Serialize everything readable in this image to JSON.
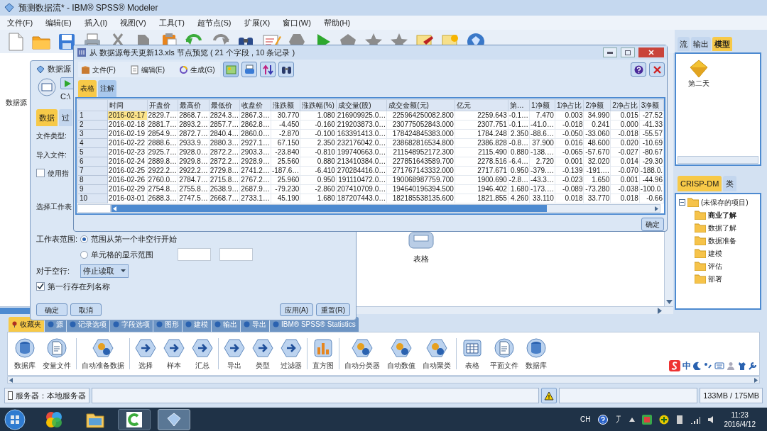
{
  "app": {
    "title": "预测数据流* - IBM® SPSS® Modeler",
    "menu": [
      "文件(F)",
      "编辑(E)",
      "插入(I)",
      "视图(V)",
      "工具(T)",
      "超节点(S)",
      "扩展(X)",
      "窗口(W)",
      "帮助(H)"
    ]
  },
  "canvas": {
    "nodes": [
      {
        "label": "数据源",
        "kind": "hidden"
      },
      {
        "label": "表格",
        "kind": "table"
      }
    ]
  },
  "managers": {
    "tabs": [
      {
        "label": "流",
        "selected": false
      },
      {
        "label": "输出",
        "selected": false
      },
      {
        "label": "模型",
        "selected": true
      }
    ],
    "models": [
      {
        "label": "第二天"
      }
    ]
  },
  "project": {
    "tabs": [
      {
        "label": "CRISP-DM",
        "selected": true
      },
      {
        "label": "类",
        "selected": false
      }
    ],
    "tree": {
      "label": "(未保存的项目)",
      "expanded": true,
      "children": [
        {
          "label": "商业了解",
          "bold": true
        },
        {
          "label": "数据了解",
          "bold": false
        },
        {
          "label": "数据准备",
          "bold": false
        },
        {
          "label": "建模",
          "bold": false
        },
        {
          "label": "评估",
          "bold": false
        },
        {
          "label": "部署",
          "bold": false
        }
      ]
    }
  },
  "palette": {
    "tabs": [
      {
        "label": "收藏夹",
        "selected": true
      },
      {
        "label": "源",
        "selected": false
      },
      {
        "label": "记录选项",
        "selected": false
      },
      {
        "label": "字段选项",
        "selected": false
      },
      {
        "label": "图形",
        "selected": false
      },
      {
        "label": "建模",
        "selected": false
      },
      {
        "label": "输出",
        "selected": false
      },
      {
        "label": "导出",
        "selected": false
      },
      {
        "label": "IBM® SPSS® Statistics",
        "selected": false
      }
    ],
    "groups": [
      [
        {
          "label": "数据库",
          "kind": "database"
        },
        {
          "label": "变量文件",
          "kind": "file"
        }
      ],
      [
        {
          "label": "自动准备数据",
          "kind": "model"
        }
      ],
      [
        {
          "label": "选择",
          "kind": "process"
        },
        {
          "label": "样本",
          "kind": "process"
        },
        {
          "label": "汇总",
          "kind": "process"
        }
      ],
      [
        {
          "label": "导出",
          "kind": "process"
        },
        {
          "label": "类型",
          "kind": "process"
        },
        {
          "label": "过滤器",
          "kind": "process"
        }
      ],
      [
        {
          "label": "直方图",
          "kind": "chart"
        }
      ],
      [
        {
          "label": "自动分类器",
          "kind": "model"
        },
        {
          "label": "自动数值",
          "kind": "model"
        },
        {
          "label": "自动聚类",
          "kind": "model"
        }
      ],
      [
        {
          "label": "表格",
          "kind": "table"
        },
        {
          "label": "平面文件",
          "kind": "file"
        },
        {
          "label": "数据库",
          "kind": "database"
        }
      ]
    ]
  },
  "ime_bar": {
    "mode": "中"
  },
  "status_bar": {
    "server": "服务器：本地服务器",
    "memory": "133MB / 175MB"
  },
  "source_dialog": {
    "title": "数据源",
    "path": "C:\\",
    "tabs": [
      {
        "label": "数据",
        "selected": true
      },
      {
        "label": "过",
        "selected": false
      }
    ],
    "file_type_label": "文件类型:",
    "import_file_label": "导入文件:",
    "use_named": {
      "label": "使用指",
      "checked": false
    },
    "sheet_label": "选择工作表",
    "range_label": "工作表范围:",
    "range_options": [
      {
        "label": "范围从第一个非空行开始",
        "selected": true
      },
      {
        "label": "单元格的显示范围",
        "selected": false
      }
    ],
    "blank_rows_label": "对于空行:",
    "blank_rows_value": "停止读取",
    "first_row_names": {
      "label": "第一行存在列名称",
      "checked": true
    },
    "buttons": [
      "确定",
      "取消",
      "应用(A)",
      "重置(R)"
    ]
  },
  "preview": {
    "title": "从 数据源每天更新13.xls 节点预览 ( 21 个字段 , 10 条记录 )",
    "menu": [
      "文件(F)",
      "编辑(E)",
      "生成(G)"
    ],
    "tabs": [
      {
        "label": "表格",
        "selected": true
      },
      {
        "label": "注解",
        "selected": false
      }
    ],
    "table": {
      "columns": [
        {
          "label": "时间",
          "kind": "text"
        },
        {
          "label": "开盘价",
          "kind": "number"
        },
        {
          "label": "最高价",
          "kind": "number"
        },
        {
          "label": "最低价",
          "kind": "number"
        },
        {
          "label": "收盘价",
          "kind": "number"
        },
        {
          "label": "涨跌额",
          "kind": "number"
        },
        {
          "label": "涨跌幅(%)",
          "kind": "number"
        },
        {
          "label": "成交量(股)",
          "kind": "number"
        },
        {
          "label": "成交金额(元)",
          "kind": "number"
        },
        {
          "label": "亿元",
          "kind": "number"
        },
        {
          "label": "第…",
          "kind": "number"
        },
        {
          "label": "1净额",
          "kind": "number"
        },
        {
          "label": "1净占比",
          "kind": "number"
        },
        {
          "label": "2净额",
          "kind": "number"
        },
        {
          "label": "2净占比",
          "kind": "number"
        },
        {
          "label": "3净额",
          "kind": "number"
        }
      ],
      "rows": [
        {
          "number": "1",
          "selected": true,
          "cells": [
            "2016-02-17",
            "2829.7…",
            "2868.7…",
            "2824.3…",
            "2867.3…",
            "30.770",
            "1.080",
            "216909925.0…",
            "225964250082.800",
            "2259.643",
            "-0.1…",
            "7.470",
            "0.003",
            "34.990",
            "0.015",
            "-27.52"
          ]
        },
        {
          "number": "2",
          "selected": false,
          "cells": [
            "2016-02-18",
            "2881.7…",
            "2893.2…",
            "2857.7…",
            "2862.8…",
            "-4.450",
            "-0.160",
            "219203873.0…",
            "230775052843.000",
            "2307.751",
            "-0.1…",
            "-41.0…",
            "-0.018",
            "0.241",
            "0.000",
            "-41.33"
          ]
        },
        {
          "number": "3",
          "selected": false,
          "cells": [
            "2016-02-19",
            "2854.9…",
            "2872.7…",
            "2840.4…",
            "2860.0…",
            "-2.870",
            "-0.100",
            "163391413.0…",
            "178424845383.000",
            "1784.248",
            "2.350",
            "-88.6…",
            "-0.050",
            "-33.060",
            "-0.018",
            "-55.57"
          ]
        },
        {
          "number": "4",
          "selected": false,
          "cells": [
            "2016-02-22",
            "2888.6…",
            "2933.9…",
            "2880.3…",
            "2927.1…",
            "67.150",
            "2.350",
            "232176042.0…",
            "238682816534.800",
            "2386.828",
            "-0.8…",
            "37.900",
            "0.016",
            "48.600",
            "0.020",
            "-10.69"
          ]
        },
        {
          "number": "5",
          "selected": false,
          "cells": [
            "2016-02-23",
            "2925.7…",
            "2928.0…",
            "2872.2…",
            "2903.3…",
            "-23.840",
            "-0.810",
            "199740663.0…",
            "211548952172.300",
            "2115.490",
            "0.880",
            "-138.…",
            "-0.065",
            "-57.670",
            "-0.027",
            "-80.67"
          ]
        },
        {
          "number": "6",
          "selected": false,
          "cells": [
            "2016-02-24",
            "2889.8…",
            "2929.8…",
            "2872.2…",
            "2928.9…",
            "25.560",
            "0.880",
            "213410384.0…",
            "227851643589.700",
            "2278.516",
            "-6.4…",
            "2.720",
            "0.001",
            "32.020",
            "0.014",
            "-29.30"
          ]
        },
        {
          "number": "7",
          "selected": false,
          "cells": [
            "2016-02-25",
            "2922.2…",
            "2922.2…",
            "2729.8…",
            "2741.2…",
            "-187.6…",
            "-6.410",
            "270284416.0…",
            "271767143332.000",
            "2717.671",
            "0.950",
            "-379.…",
            "-0.139",
            "-191.…",
            "-0.070",
            "-188.0."
          ]
        },
        {
          "number": "8",
          "selected": false,
          "cells": [
            "2016-02-26",
            "2760.0…",
            "2784.7…",
            "2715.8…",
            "2767.2…",
            "25.960",
            "0.950",
            "191110472.0…",
            "190068987759.700",
            "1900.690",
            "-2.8…",
            "-43.3…",
            "-0.023",
            "1.650",
            "0.001",
            "-44.96"
          ]
        },
        {
          "number": "9",
          "selected": false,
          "cells": [
            "2016-02-29",
            "2754.8…",
            "2755.8…",
            "2638.9…",
            "2687.9…",
            "-79.230",
            "-2.860",
            "207410709.0…",
            "194640196394.500",
            "1946.402",
            "1.680",
            "-173.…",
            "-0.089",
            "-73.280",
            "-0.038",
            "-100.0."
          ]
        },
        {
          "number": "10",
          "selected": false,
          "cells": [
            "2016-03-01",
            "2688.3…",
            "2747.5…",
            "2668.7…",
            "2733.1…",
            "45.190",
            "1.680",
            "187207443.0…",
            "182185538135.600",
            "1821.855",
            "4.260",
            "33.110",
            "0.018",
            "33.770",
            "0.018",
            "-0.66"
          ]
        }
      ]
    },
    "ok_button": "确定"
  },
  "taskbar": {
    "language": "CH",
    "time": "11:23",
    "date": "2016/4/12"
  }
}
